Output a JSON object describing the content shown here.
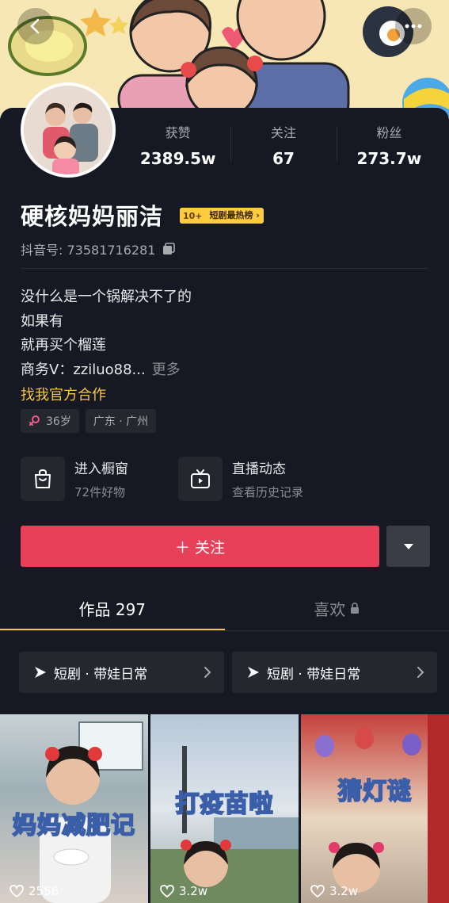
{
  "header": {
    "back_icon": "chevron-left-icon",
    "more_icon": "more-dots-icon"
  },
  "profile": {
    "stats": [
      {
        "label": "获赞",
        "value": "2389.5w"
      },
      {
        "label": "关注",
        "value": "67"
      },
      {
        "label": "粉丝",
        "value": "273.7w"
      }
    ],
    "name": "硬核妈妈丽洁",
    "rank_badge": {
      "num": "10+",
      "text": "短剧最热榜 ›"
    },
    "douyin_id": "抖音号: 73581716281",
    "bio_lines": [
      "没什么是一个锅解决不了的",
      "如果有",
      "就再买个榴莲",
      "商务V：zziluo88..."
    ],
    "bio_more": "更多",
    "official_link": "找我官方合作",
    "tags": [
      {
        "icon": "female-icon",
        "label": "36岁"
      },
      {
        "label": "广东 · 广州"
      }
    ]
  },
  "entries": [
    {
      "icon": "shopping-bag-icon",
      "title": "进入橱窗",
      "subtitle": "72件好物"
    },
    {
      "icon": "tv-icon",
      "title": "直播动态",
      "subtitle": "查看历史记录"
    }
  ],
  "actions": {
    "follow_label": "＋ 关注",
    "dropdown_icon": "triangle-down-icon"
  },
  "tabs": [
    {
      "label": "作品 297",
      "active": true
    },
    {
      "label": "喜欢",
      "active": false,
      "icon": "lock-icon"
    }
  ],
  "collections": [
    {
      "label": "短剧 · 带娃日常"
    },
    {
      "label": "短剧 · 带娃日常"
    }
  ],
  "videos": [
    {
      "title": "妈妈减肥记",
      "likes": "2556"
    },
    {
      "title": "打疫苗啦",
      "likes": "3.2w"
    },
    {
      "title": "猜灯谜",
      "likes": "3.2w"
    }
  ],
  "colors": {
    "background": "#161823",
    "follow": "#e9405a",
    "accent_gold": "#f5c543"
  }
}
